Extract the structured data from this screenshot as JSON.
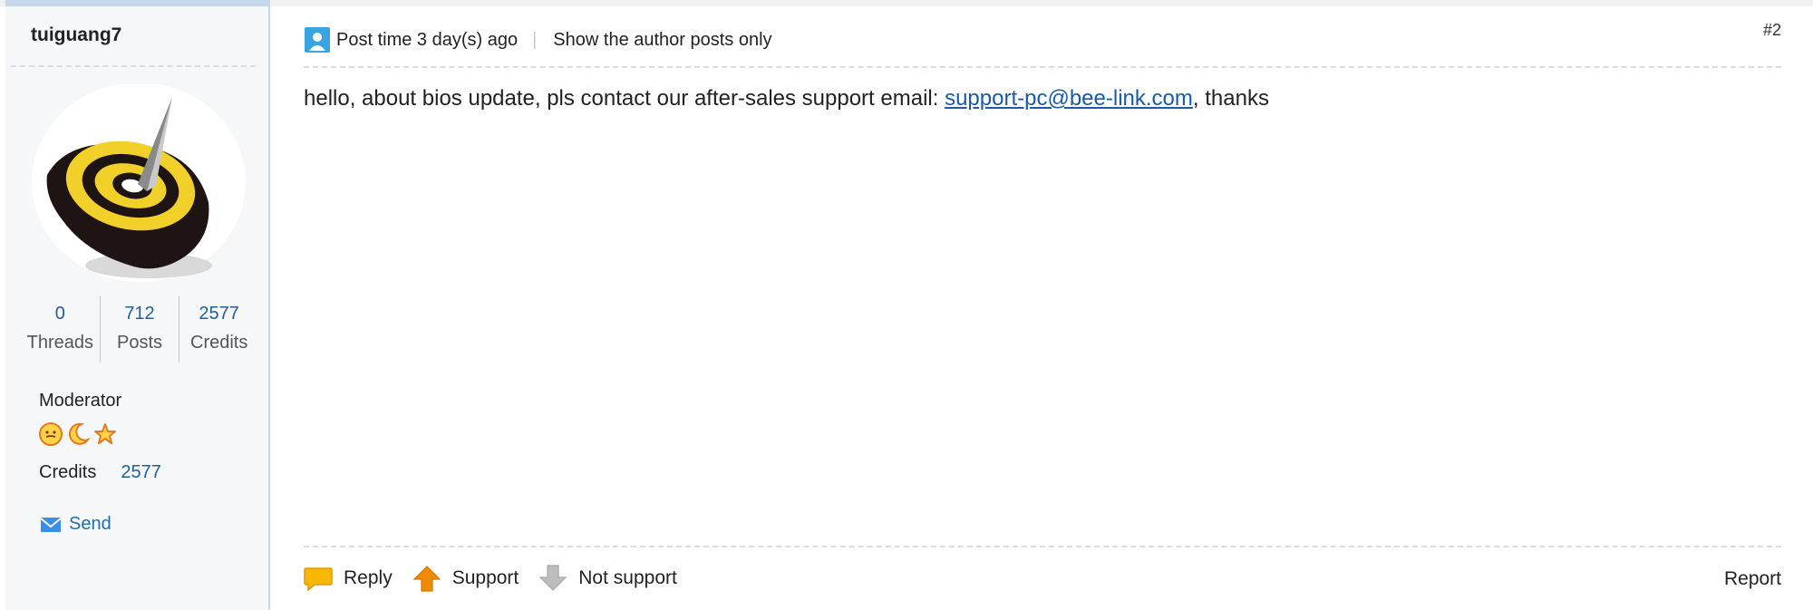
{
  "author": {
    "username": "tuiguang7",
    "stats": [
      {
        "value": "0",
        "label": "Threads"
      },
      {
        "value": "712",
        "label": "Posts"
      },
      {
        "value": "2577",
        "label": "Credits"
      }
    ],
    "group": "Moderator",
    "credits_label": "Credits",
    "credits_value": "2577",
    "send_label": "Send"
  },
  "post": {
    "time_label": "Post time 3 day(s) ago",
    "author_only_label": "Show the author posts only",
    "floor": "#2",
    "content_prefix": "hello, about bios update, pls contact our after-sales support email: ",
    "content_link": "support-pc@bee-link.com",
    "content_suffix": ", thanks"
  },
  "actions": {
    "reply": "Reply",
    "support": "Support",
    "not_support": "Not support",
    "report": "Report"
  },
  "colors": {
    "link": "#1a5aa8",
    "stat_value": "#1f5f99",
    "sidebar_bg": "#f6f7f9",
    "sidebar_border": "#c7d9ec"
  }
}
